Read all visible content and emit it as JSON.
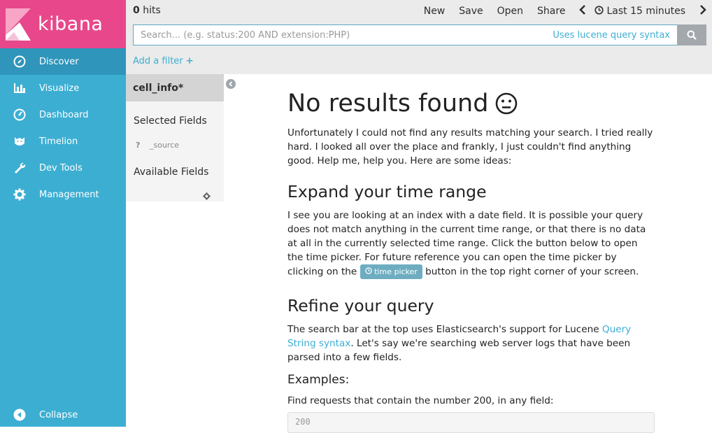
{
  "app": {
    "logo_text": "kibana",
    "brand_color": "#e8488b",
    "sidebar_color": "#3caed2"
  },
  "sidebar": {
    "items": [
      {
        "label": "Discover",
        "icon": "compass-icon",
        "active": true
      },
      {
        "label": "Visualize",
        "icon": "bar-chart-icon"
      },
      {
        "label": "Dashboard",
        "icon": "dashboard-icon"
      },
      {
        "label": "Timelion",
        "icon": "timelion-icon"
      },
      {
        "label": "Dev Tools",
        "icon": "wrench-icon"
      },
      {
        "label": "Management",
        "icon": "gear-icon"
      }
    ],
    "collapse_label": "Collapse"
  },
  "topbar": {
    "hits_count": "0",
    "hits_label": " hits",
    "menu": {
      "new": "New",
      "save": "Save",
      "open": "Open",
      "share": "Share"
    },
    "time_range": "Last 15 minutes",
    "search_placeholder": "Search... (e.g. status:200 AND extension:PHP)",
    "search_value": "",
    "lucene_link": "Uses lucene query syntax",
    "add_filter": "Add a filter"
  },
  "fields": {
    "index_pattern": "cell_info*",
    "selected_fields_label": "Selected Fields",
    "source_type": "?",
    "source_field": "_source",
    "available_fields_label": "Available Fields"
  },
  "main": {
    "title": "No results found",
    "intro": "Unfortunately I could not find any results matching your search. I tried really hard. I looked all over the place and frankly, I just couldn't find anything good. Help me, help you. Here are some ideas:",
    "expand_heading": "Expand your time range",
    "expand_text_1": "I see you are looking at an index with a date field. It is possible your query does not match anything in the current time range, or that there is no data at all in the currently selected time range. Click the button below to open the time picker. For future reference you can open the time picker by clicking on the",
    "time_picker_btn": "time picker",
    "expand_text_2": " button in the top right corner of your screen.",
    "refine_heading": "Refine your query",
    "refine_text_1": "The search bar at the top uses Elasticsearch's support for Lucene ",
    "refine_link": "Query String syntax",
    "refine_text_2": ". Let's say we're searching web server logs that have been parsed into a few fields.",
    "examples_heading": "Examples:",
    "example_1_text": "Find requests that contain the number 200, in any field:",
    "example_1_code": "200"
  }
}
